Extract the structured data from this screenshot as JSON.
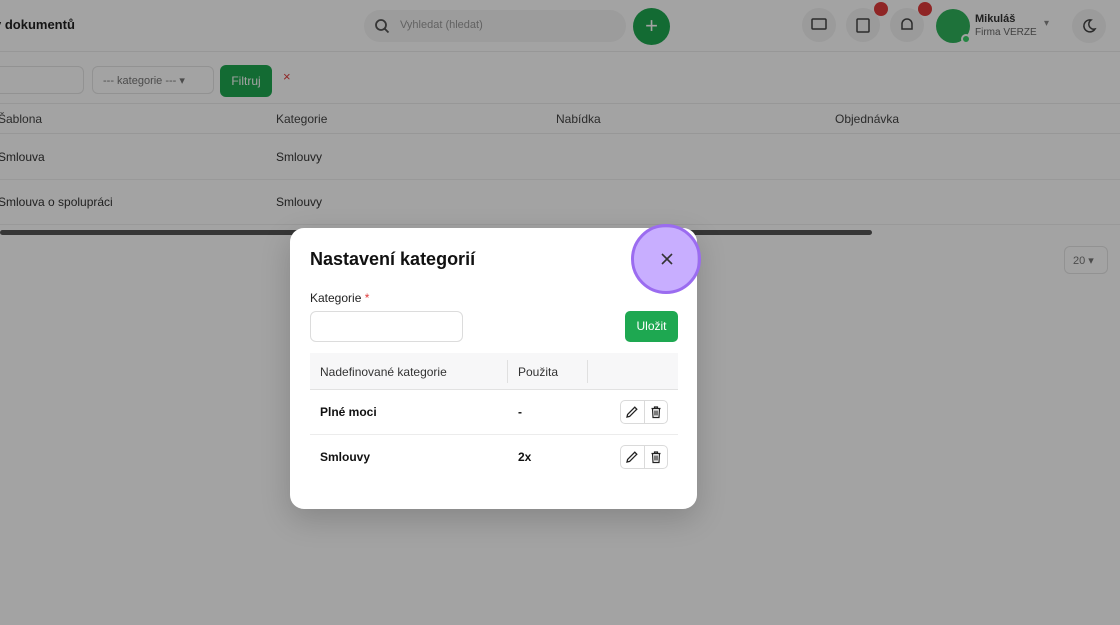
{
  "app": {
    "title": "y dokumentů"
  },
  "search": {
    "placeholder": "Vyhledat (hledat)"
  },
  "user": {
    "name": "Mikuláš",
    "subtitle": "Firma VERZE"
  },
  "filters": {
    "category_select": "--- kategorie ---",
    "filter_button": "Filtruj",
    "clear": "×"
  },
  "table": {
    "headers": [
      "Šablona",
      "Kategorie",
      "Nabídka",
      "Objednávka"
    ],
    "rows": [
      {
        "template": "Smlouva",
        "category": "Smlouvy"
      },
      {
        "template": "Smlouva o spolupráci",
        "category": "Smlouvy"
      }
    ]
  },
  "pager": {
    "per_page": "20"
  },
  "modal": {
    "title": "Nastavení kategorií",
    "field_label": "Kategorie",
    "required_mark": "*",
    "input_value": "",
    "save_label": "Uložit",
    "table_headers": {
      "name": "Nadefinované kategorie",
      "used": "Použita"
    },
    "categories": [
      {
        "name": "Plné moci",
        "used": "-"
      },
      {
        "name": "Smlouvy",
        "used": "2x"
      }
    ]
  },
  "colors": {
    "accent": "#1ea851",
    "highlight": "#9b6cf0",
    "danger": "#e03b3b"
  }
}
